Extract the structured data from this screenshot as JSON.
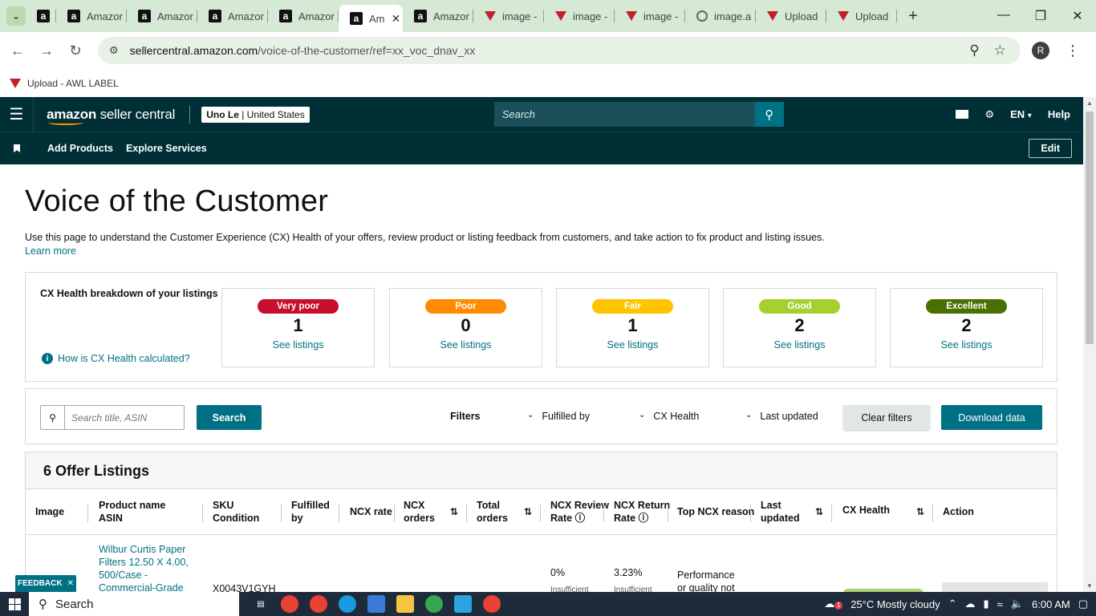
{
  "browser": {
    "tabs": [
      {
        "label": "",
        "icon": "amazon-icon"
      },
      {
        "label": "Amazor",
        "icon": "amazon-icon"
      },
      {
        "label": "Amazor",
        "icon": "amazon-icon"
      },
      {
        "label": "Amazor",
        "icon": "amazon-icon"
      },
      {
        "label": "Amazor",
        "icon": "amazon-icon"
      },
      {
        "label": "Am",
        "icon": "amazon-icon",
        "active": true
      },
      {
        "label": "Amazor",
        "icon": "amazon-icon"
      },
      {
        "label": "image -",
        "icon": "awl-icon"
      },
      {
        "label": "image -",
        "icon": "awl-icon"
      },
      {
        "label": "image -",
        "icon": "awl-icon"
      },
      {
        "label": "image.a",
        "icon": "globe-icon"
      },
      {
        "label": "Upload",
        "icon": "awl-icon"
      },
      {
        "label": "Upload",
        "icon": "awl-icon"
      }
    ],
    "url_host": "sellercentral.amazon.com",
    "url_path": "/voice-of-the-customer/ref=xx_voc_dnav_xx",
    "profile_initial": "R",
    "bookmark": "Upload - AWL LABEL"
  },
  "header": {
    "logo_brand": "amazon",
    "logo_product": " seller central",
    "account_name": "Uno Le",
    "account_region": " | United States",
    "search_placeholder": "Search",
    "language": "EN",
    "help": "Help"
  },
  "nav": {
    "links": [
      "Add Products",
      "Explore Services"
    ],
    "edit": "Edit"
  },
  "page": {
    "title": "Voice of the Customer",
    "description": "Use this page to understand the Customer Experience (CX) Health of your offers, review product or listing feedback from customers, and take action to fix product and listing issues.",
    "learn_more": "Learn more"
  },
  "health": {
    "label": "CX Health breakdown of your listings",
    "how_link": "How is CX Health calculated?",
    "cards": [
      {
        "label": "Very poor",
        "count": "1",
        "link": "See listings",
        "color": "#c7102e"
      },
      {
        "label": "Poor",
        "count": "0",
        "link": "See listings",
        "color": "#ff8c00"
      },
      {
        "label": "Fair",
        "count": "1",
        "link": "See listings",
        "color": "#ffc300"
      },
      {
        "label": "Good",
        "count": "2",
        "link": "See listings",
        "color": "#a6d02f"
      },
      {
        "label": "Excellent",
        "count": "2",
        "link": "See listings",
        "color": "#497000"
      }
    ]
  },
  "filters": {
    "search_placeholder": "Search title, ASIN",
    "search_button": "Search",
    "label": "Filters",
    "fulfilled_by": "Fulfilled by",
    "cx_health": "CX Health",
    "last_updated": "Last updated",
    "clear": "Clear filters",
    "download": "Download data"
  },
  "listings": {
    "title": "6 Offer Listings",
    "columns": {
      "image": "Image",
      "product_1": "Product name",
      "product_2": "ASIN",
      "sku_1": "SKU",
      "sku_2": "Condition",
      "fulfilled_1": "Fulfilled",
      "fulfilled_2": "by",
      "ncx_rate": "NCX rate",
      "ncx_orders_1": "NCX",
      "ncx_orders_2": "orders",
      "total_orders_1": "Total",
      "total_orders_2": "orders",
      "review_rate_1": "NCX Review",
      "review_rate_2": "Rate",
      "return_rate_1": "NCX Return",
      "return_rate_2": "Rate",
      "top_reason": "Top NCX reason",
      "last_updated_1": "Last",
      "last_updated_2": "updated",
      "cx_health": "CX Health",
      "action": "Action"
    },
    "row1": {
      "product_lines": [
        "Wilbur Curtis Paper",
        "Filters 12.50 X 4.00,",
        "500/Case -",
        "Commercial-Grade"
      ],
      "sku": "X0043V1GYH",
      "review_rate": "0%",
      "review_note": "Insufficient",
      "return_rate": "3.23%",
      "return_note": "Insufficient",
      "reason_lines": [
        "Performance",
        "or quality not"
      ]
    }
  },
  "feedback": "FEEDBACK",
  "taskbar": {
    "search": "Search",
    "weather_badge": "1",
    "weather": "25°C  Mostly cloudy",
    "time": "6:00 AM"
  }
}
